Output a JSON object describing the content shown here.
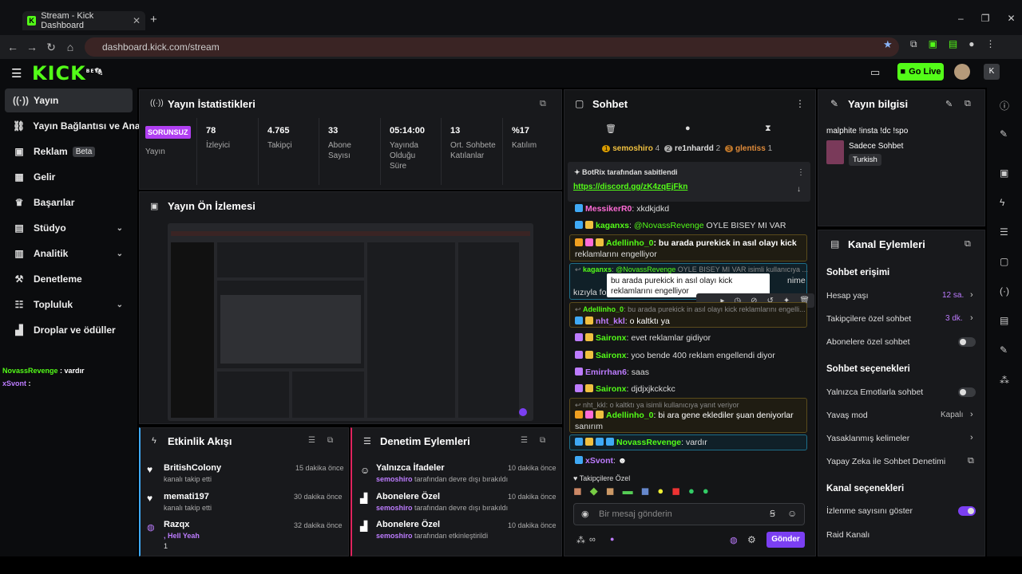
{
  "browser": {
    "tab_title": "Stream - Kick Dashboard",
    "url": "dashboard.kick.com/stream"
  },
  "header": {
    "logo": "KICK",
    "logo_sup": "BETA",
    "go_live": "Go Live"
  },
  "sidebar": {
    "items": [
      {
        "label": "Yayın",
        "icon": "broadcast-icon"
      },
      {
        "label": "Yayın Bağlantısı ve Anahtarı",
        "icon": "link-icon"
      },
      {
        "label": "Reklam",
        "icon": "ad-icon",
        "badge": "Beta"
      },
      {
        "label": "Gelir",
        "icon": "revenue-icon"
      },
      {
        "label": "Başarılar",
        "icon": "trophy-icon"
      },
      {
        "label": "Stüdyo",
        "icon": "studio-icon"
      },
      {
        "label": "Analitik",
        "icon": "analytics-icon"
      },
      {
        "label": "Denetleme",
        "icon": "hammer-icon"
      },
      {
        "label": "Topluluk",
        "icon": "community-icon"
      },
      {
        "label": "Droplar ve ödüller",
        "icon": "gift-icon"
      }
    ],
    "chat_overlay": [
      {
        "user": "NovassRevenge",
        "text": " : vardır"
      },
      {
        "user": "xSvont",
        "text": " :"
      }
    ]
  },
  "stats": {
    "title": "Yayın İstatistikleri",
    "status_badge": "SORUNSUZ",
    "status_label": "Yayın",
    "items": [
      {
        "value": "78",
        "label": "İzleyici"
      },
      {
        "value": "4.765",
        "label": "Takipçi"
      },
      {
        "value": "33",
        "label": "Abone Sayısı"
      },
      {
        "value": "05:14:00",
        "label": "Yayında Olduğu Süre"
      },
      {
        "value": "13",
        "label": "Ort. Sohbete Katılanlar"
      },
      {
        "value": "%17",
        "label": "Katılım"
      }
    ]
  },
  "preview": {
    "title": "Yayın Ön İzlemesi"
  },
  "activity": {
    "title": "Etkinlik Akışı",
    "items": [
      {
        "name": "BritishColony",
        "desc": "kanalı takip etti",
        "time": "15 dakika önce"
      },
      {
        "name": "memati197",
        "desc": "kanalı takip etti",
        "time": "30 dakika önce"
      },
      {
        "name": "Razqx",
        "desc": ", Hell Yeah",
        "extra": "1",
        "time": "32 dakika önce"
      }
    ]
  },
  "moderation": {
    "title": "Denetim Eylemleri",
    "items": [
      {
        "name": "Yalnızca İfadeler",
        "user": "semoshiro",
        "desc": " tarafından devre dışı bırakıldı",
        "time": "10 dakika önce"
      },
      {
        "name": "Abonelere Özel",
        "user": "semoshiro",
        "desc": " tarafından devre dışı bırakıldı",
        "time": "10 dakika önce"
      },
      {
        "name": "Abonelere Özel",
        "user": "semoshiro",
        "desc": " tarafından etkinleştirildi",
        "time": "10 dakika önce"
      }
    ]
  },
  "chat": {
    "title": "Sohbet",
    "top_users": [
      {
        "rank": "1",
        "name": "semoshiro",
        "count": "4"
      },
      {
        "rank": "2",
        "name": "re1nhardd",
        "count": "2"
      },
      {
        "rank": "3",
        "name": "glentiss",
        "count": "1"
      }
    ],
    "pinned_by": "BotRix tarafından sabitlendi",
    "pinned_link": "https://discord.gg/zK4zqEjFkn",
    "messages": [
      {
        "user": "MessikerR0",
        "color": "#ff6bd6",
        "text": ": xkdkjdkd"
      },
      {
        "user": "kaganxs",
        "color": "#53fc18",
        "text": ": ",
        "mention": "@NovassRevenge",
        "rest": " OYLE BISEY MI VAR"
      },
      {
        "user": "Adellinho_0",
        "color": "#53fc18",
        "text": ": bu arada purekick in asıl olayı kick",
        "line2": "reklamlarını engelliyor"
      },
      {
        "reply_user": "kaganxs",
        "reply_mention": "@NovassRevenge",
        "reply_text": " OYLE BISEY MI VAR isimli kullanıcıya ...",
        "line_a": "nime",
        "line_b": "kızıyla fo"
      },
      {
        "reply_user": "Adellinho_0",
        "reply_text": ": bu arada purekick in asıl olayı kick reklamlarını engelli...",
        "user": "nht_kkl",
        "color": "#bd7cff",
        "text": ": o kaltktı ya"
      },
      {
        "user": "Saironx",
        "color": "#53fc18",
        "text": ": evet reklamlar gidiyor"
      },
      {
        "user": "Saironx",
        "color": "#53fc18",
        "text": ": yoo bende 400 reklam engellendi diyor"
      },
      {
        "user": "Emirrhan6",
        "color": "#bd7cff",
        "text": ": saas"
      },
      {
        "user": "Saironx",
        "color": "#53fc18",
        "text": ": djdjxjkckckc"
      },
      {
        "reply_text": "nht_kkl: o kaltktı ya isimli kullanıcıya yanıt veriyor",
        "user": "Adellinho_0",
        "color": "#53fc18",
        "text": ": bi ara gene ekledil‌er şuan deniyorlar",
        "line2": "sanırım"
      },
      {
        "user": "NovassRevenge",
        "color": "#53fc18",
        "text": ": vardır"
      },
      {
        "user": "xSvont",
        "color": "#bd7cff",
        "text": ":"
      }
    ],
    "tooltip": "bu arada purekick in asıl olayı kick reklamlarını engelliyor",
    "followers_only": "Takipçilere Özel",
    "input_placeholder": "Bir mesaj gönderin",
    "send": "Gönder"
  },
  "stream_info": {
    "title": "Yayın bilgisi",
    "stream_title": "malphite !insta !dc !spo",
    "category": "Sadece Sohbet",
    "language": "Turkish"
  },
  "channel_actions": {
    "title": "Kanal Eylemleri",
    "chat_access": "Sohbet erişimi",
    "account_age": {
      "label": "Hesap yaşı",
      "value": "12 sa."
    },
    "followers_chat": {
      "label": "Takipçilere özel sohbet",
      "value": "3 dk."
    },
    "subs_chat": {
      "label": "Abonelere özel sohbet",
      "on": false
    },
    "chat_options": "Sohbet seçenekleri",
    "emotes_only": {
      "label": "Yalnızca Emotlarla sohbet",
      "on": false
    },
    "slow_mode": {
      "label": "Yavaş mod",
      "value": "Kapalı"
    },
    "banned_words": "Yasaklanmış kelimeler",
    "ai_mod": "Yapay Zeka ile Sohbet Denetimi",
    "channel_options": "Kanal seçenekleri",
    "show_viewers": {
      "label": "İzlenme sayısını göster",
      "on": true
    },
    "raid": "Raid Kanalı"
  }
}
